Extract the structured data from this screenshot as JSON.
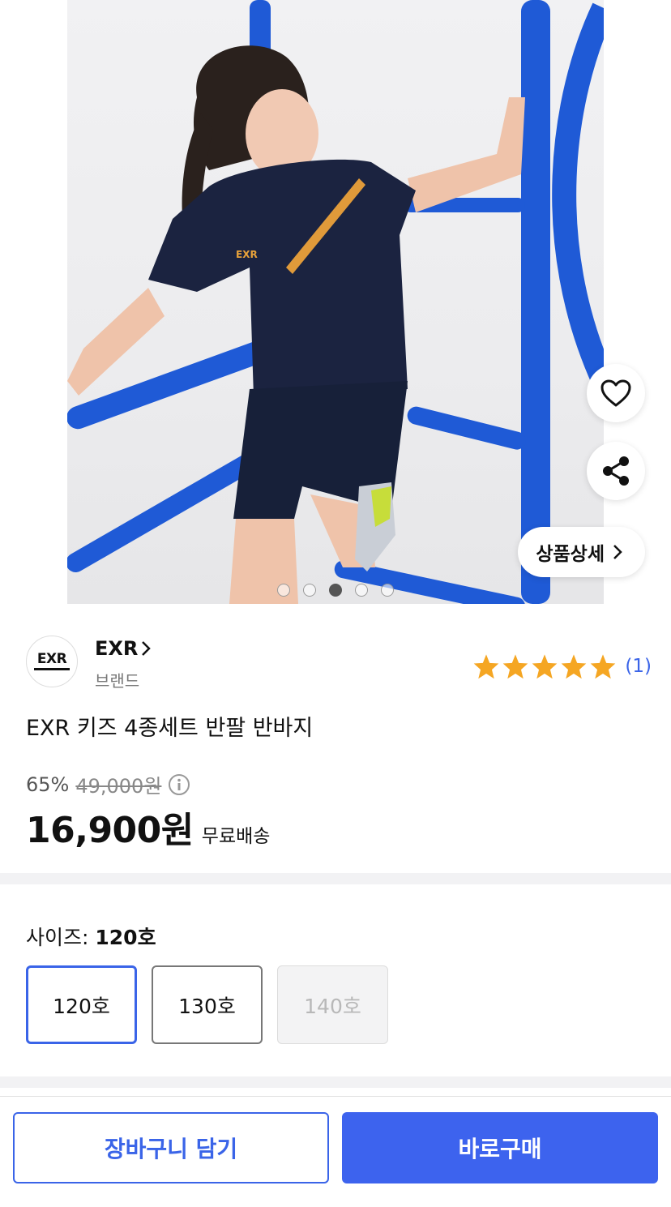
{
  "hero": {
    "image_alt": "EXR 키즈 티셔츠를 입은 어린이",
    "detail_label": "상품상세",
    "carousel": {
      "count": 5,
      "active_index": 2
    }
  },
  "brand": {
    "logo_text": "EXR",
    "name": "EXR",
    "subtitle": "브랜드"
  },
  "rating": {
    "stars": 5,
    "count_label": "(1)"
  },
  "product": {
    "title": "EXR 키즈 4종세트 반팔 반바지",
    "discount_pct": "65%",
    "original_price": "49,000원",
    "price": "16,900원",
    "shipping": "무료배송"
  },
  "size": {
    "label": "사이즈:",
    "selected_value": "120호",
    "options": [
      {
        "label": "120호",
        "state": "selected"
      },
      {
        "label": "130호",
        "state": "available"
      },
      {
        "label": "140호",
        "state": "disabled"
      }
    ]
  },
  "actions": {
    "cart_label": "장바구니 담기",
    "buy_label": "바로구매"
  },
  "colors": {
    "accent": "#3a64e8",
    "star": "#f5a623",
    "shirt": "#1b2340",
    "bar": "#1f5ad6"
  },
  "icons": [
    "heart-icon",
    "share-icon",
    "chevron-right-icon",
    "info-icon",
    "star-icon"
  ]
}
